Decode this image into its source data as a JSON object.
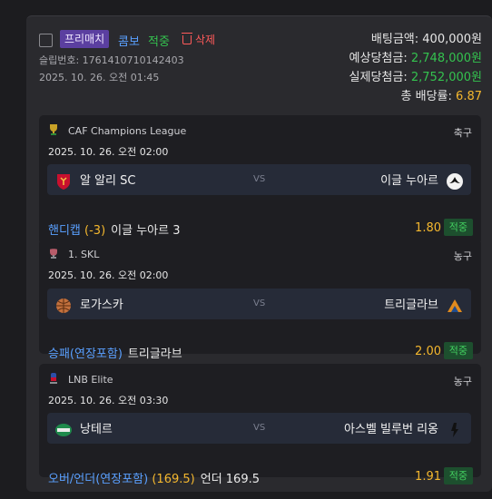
{
  "slip": {
    "badge_prematch": "프리매치",
    "type_label": "콤보",
    "result_label": "적중",
    "delete_label": "삭제",
    "slip_number": "슬립번호: 1761410710142403",
    "datetime": "2025. 10. 26. 오전 01:45",
    "bet_amount_label": "배팅금액:",
    "bet_amount": "400,000원",
    "expected_payout_label": "예상당첨금:",
    "expected_payout": "2,748,000원",
    "actual_payout_label": "실제당첨금:",
    "actual_payout": "2,752,000원",
    "total_odds_label": "총 배당률:",
    "total_odds": "6.87"
  },
  "matches": [
    {
      "league": "CAF Champions League",
      "sport": "축구",
      "date": "2025. 10. 26. 오전 02:00",
      "home": "알 알리 SC",
      "away": "이글 누아르",
      "vs": "VS",
      "market": "핸디캡",
      "market_line": "(-3)",
      "pick": "이글 누아르 3",
      "odds": "1.80",
      "result": "적중"
    },
    {
      "league": "1. SKL",
      "sport": "농구",
      "date": "2025. 10. 26. 오전 02:00",
      "home": "로가스카",
      "away": "트리글라브",
      "vs": "VS",
      "market": "승패(연장포함)",
      "market_line": "",
      "pick": "트리글라브",
      "odds": "2.00",
      "result": "적중"
    },
    {
      "league": "LNB Elite",
      "sport": "농구",
      "date": "2025. 10. 26. 오전 03:30",
      "home": "낭테르",
      "away": "아스벨 빌루번 리옹",
      "vs": "VS",
      "market": "오버/언더(연장포함)",
      "market_line": "(169.5)",
      "pick": "언더 169.5",
      "odds": "1.91",
      "result": "적중"
    }
  ]
}
